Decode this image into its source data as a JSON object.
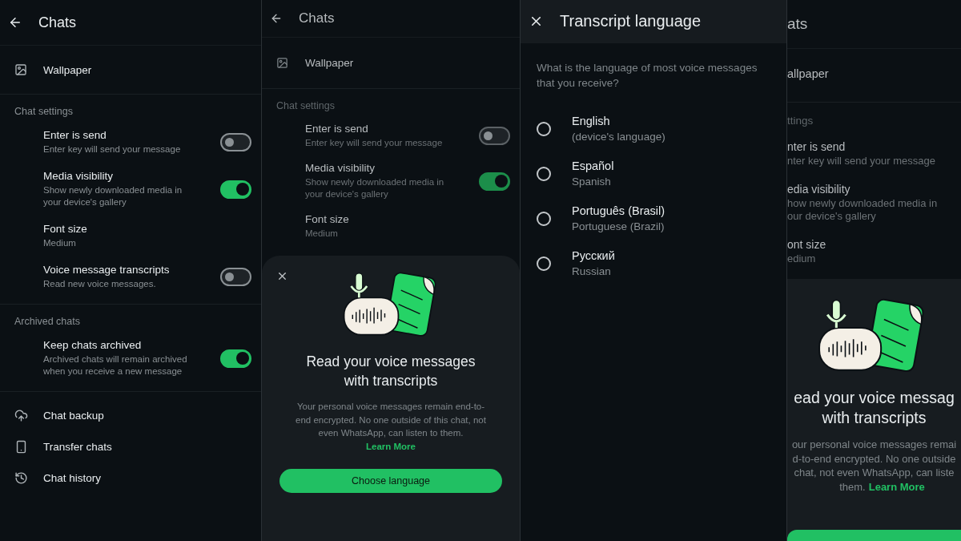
{
  "chat_settings": {
    "title": "Chats",
    "wallpaper": "Wallpaper",
    "sections": [
      {
        "heading": "Chat settings",
        "items": [
          {
            "kind": "toggle",
            "title": "Enter is send",
            "subtitle": "Enter key will send your message",
            "on": false
          },
          {
            "kind": "toggle",
            "title": "Media visibility",
            "subtitle": "Show newly downloaded media in your device's gallery",
            "on": true
          },
          {
            "kind": "value",
            "title": "Font size",
            "subtitle": "Medium"
          },
          {
            "kind": "toggle",
            "title": "Voice message transcripts",
            "subtitle": "Read new voice messages.",
            "on": false
          }
        ]
      },
      {
        "heading": "Archived chats",
        "items": [
          {
            "kind": "toggle",
            "title": "Keep chats archived",
            "subtitle": "Archived chats will remain archived when you receive a new message",
            "on": true
          }
        ]
      }
    ],
    "bottom_items": [
      {
        "kind": "backup",
        "label": "Chat backup"
      },
      {
        "kind": "transfer",
        "label": "Transfer chats"
      },
      {
        "kind": "history",
        "label": "Chat history"
      }
    ]
  },
  "transcript_prompt": {
    "background": {
      "title": "Chats",
      "wallpaper": "Wallpaper",
      "heading": "Chat settings",
      "items": [
        {
          "kind": "toggle",
          "title": "Enter is send",
          "subtitle": "Enter key will send your message",
          "on": false
        },
        {
          "kind": "toggle",
          "title": "Media visibility",
          "subtitle": "Show newly downloaded media in your device's gallery",
          "on": true
        },
        {
          "kind": "value",
          "title": "Font size",
          "subtitle": "Medium"
        }
      ]
    },
    "sheet": {
      "title": "Read your voice messages with transcripts",
      "body": "Your personal voice messages remain end-to-end encrypted. No one outside of this chat, not even WhatsApp, can listen to them.",
      "link": "Learn More",
      "button": "Choose language"
    }
  },
  "transcript_language": {
    "title": "Transcript language",
    "question": "What is the language of most voice messages that you receive?",
    "options": [
      {
        "name": "English",
        "note": "(device's language)",
        "selected": false
      },
      {
        "name": "Español",
        "note": "Spanish",
        "selected": false
      },
      {
        "name": "Português (Brasil)",
        "note": "Portuguese (Brazil)",
        "selected": false
      },
      {
        "name": "Русский",
        "note": "Russian",
        "selected": false
      }
    ]
  },
  "cropped_prompt": {
    "title": "ats",
    "wallpaper": "allpaper",
    "heading": "ttings",
    "items": [
      {
        "title": "nter is send",
        "subtitle_lines": [
          "nter key will send your message"
        ]
      },
      {
        "title": "edia visibility",
        "subtitle_lines": [
          "how newly downloaded media in",
          "our device's gallery"
        ]
      },
      {
        "title": "ont size",
        "subtitle_lines": [
          "edium"
        ]
      }
    ],
    "sheet": {
      "title_lines": [
        "ead your voice messag",
        "with transcripts"
      ],
      "body_lines": [
        "our personal voice messages remai",
        "d-to-end encrypted. No one outside",
        "chat, not even WhatsApp, can liste"
      ],
      "last_line": "them.",
      "link": "Learn More"
    }
  }
}
